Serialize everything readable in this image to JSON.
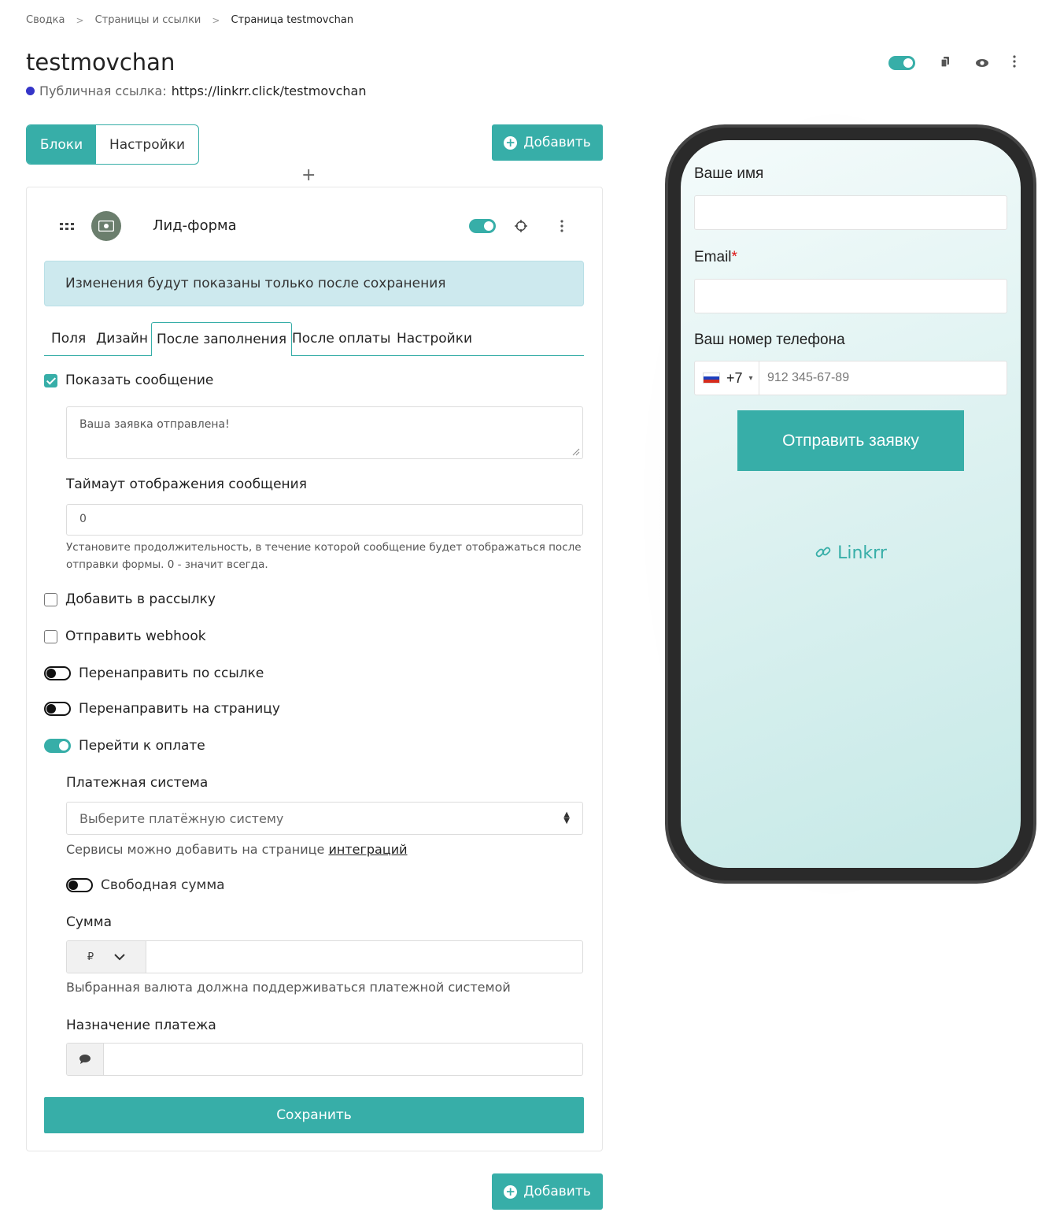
{
  "breadcrumb": {
    "items": [
      "Сводка",
      "Страницы и ссылки",
      "Страница testmovchan"
    ],
    "separator": ">"
  },
  "header": {
    "title": "testmovchan",
    "public_link_label": "Публичная ссылка:",
    "public_link_url": "https://linkrr.click/testmovchan"
  },
  "view_switch": {
    "blocks": "Блоки",
    "settings": "Настройки"
  },
  "add_button_label": "Добавить",
  "plus": "+",
  "block": {
    "name": "Лид-форма",
    "enabled": true,
    "alert": "Изменения будут показаны только после сохранения",
    "tabs": [
      "Поля",
      "Дизайн",
      "После заполнения",
      "После оплаты",
      "Настройки"
    ],
    "active_tab": "После заполнения"
  },
  "after_fill": {
    "show_message": {
      "label": "Показать сообщение",
      "checked": true
    },
    "message_text": "Ваша заявка отправлена!",
    "timeout_label": "Таймаут отображения сообщения",
    "timeout_value": "0",
    "timeout_help_line1": "Установите продолжительность, в течение которой сообщение будет отображаться после",
    "timeout_help_line2": "отправки формы. 0 - значит всегда.",
    "add_to_mailing": {
      "label": "Добавить в рассылку",
      "checked": false
    },
    "send_webhook": {
      "label": "Отправить webhook",
      "checked": false
    },
    "redirect_link": {
      "label": "Перенаправить по ссылке",
      "on": false
    },
    "redirect_page": {
      "label": "Перенаправить на страницу",
      "on": false
    },
    "go_to_payment": {
      "label": "Перейти к оплате",
      "on": true
    },
    "payment_system_label": "Платежная система",
    "payment_system_placeholder": "Выберите платёжную систему",
    "services_help_prefix": "Сервисы можно добавить на странице",
    "services_help_link": "интеграций",
    "free_amount": {
      "label": "Свободная сумма",
      "on": false
    },
    "amount_label": "Сумма",
    "currency": "₽",
    "amount_value": "",
    "currency_help": "Выбранная валюта должна поддерживаться платежной системой",
    "purpose_label": "Назначение платежа",
    "purpose_value": ""
  },
  "save_button_label": "Сохранить",
  "preview": {
    "name_label": "Ваше имя",
    "email_label": "Email",
    "email_required_mark": "*",
    "phone_label": "Ваш номер телефона",
    "phone_code": "+7",
    "phone_placeholder": "912 345-67-89",
    "submit_label": "Отправить заявку",
    "logo_text": "Linkrr"
  },
  "colors": {
    "accent": "#37aea8",
    "alert_bg": "#cde9ee",
    "link_dot": "#3535c8"
  }
}
